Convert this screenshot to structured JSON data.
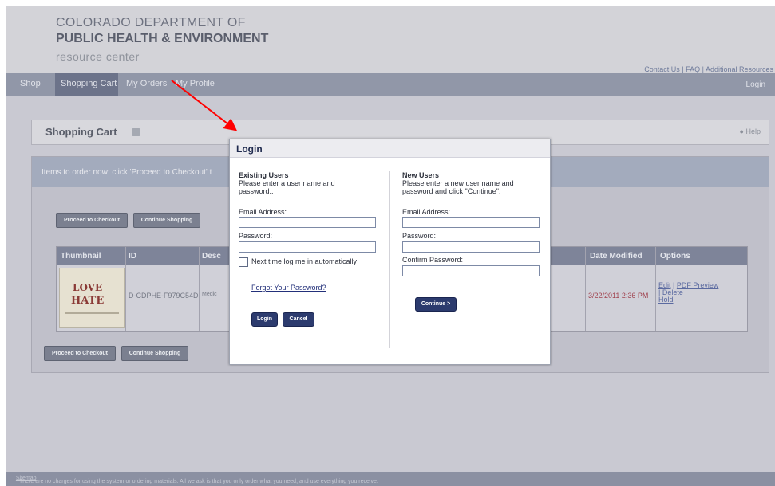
{
  "header": {
    "line1": "COLORADO DEPARTMENT OF",
    "line2": "PUBLIC HEALTH & ENVIRONMENT",
    "line3": "resource center",
    "links": [
      "Contact Us",
      "FAQ",
      "Additional Resources"
    ]
  },
  "nav": {
    "items": [
      "Shop",
      "Shopping Cart",
      "My Orders",
      "My Profile"
    ],
    "login": "Login"
  },
  "page": {
    "title": "Shopping Cart",
    "help": "Help",
    "instructions": "Items to order now: click 'Proceed to Checkout' t",
    "proceed_label": "Proceed to Checkout",
    "continue_label": "Continue Shopping"
  },
  "table": {
    "headers": [
      "Thumbnail",
      "ID",
      "Desc",
      "Date Modified",
      "Options"
    ],
    "row": {
      "thumb_line1": "LOVE",
      "thumb_line2": "HATE",
      "id": "D-CDPHE-F979C54D",
      "desc": "Medic",
      "date": "3/22/2011 2:36 PM",
      "options": [
        "Edit",
        "PDF Preview",
        "Delete",
        "Hold"
      ]
    }
  },
  "footer": {
    "text": "There are no charges for using the system or ordering materials. All we ask is that you only order what you need, and use everything you receive.",
    "link": "Sitemap"
  },
  "dialog": {
    "title": "Login",
    "existing": {
      "heading": "Existing Users",
      "desc_line1": "Please enter a user name and",
      "desc_line2": "password..",
      "email_label": "Email Address:",
      "password_label": "Password:",
      "remember_label": "Next time log me in automatically",
      "forgot": "Forgot Your Password?",
      "login_btn": "Login",
      "cancel_btn": "Cancel"
    },
    "new": {
      "heading": "New Users",
      "desc_line1": "Please enter a new user name and",
      "desc_line2": "password and click \"Continue\".",
      "email_label": "Email Address:",
      "password_label": "Password:",
      "confirm_label": "Confirm Password:",
      "continue_btn": "Continue >"
    }
  },
  "colors": {
    "annotation_arrow": "#ff0000",
    "nav_active": "#6c738a",
    "button_blue": "#2c3b6e"
  }
}
